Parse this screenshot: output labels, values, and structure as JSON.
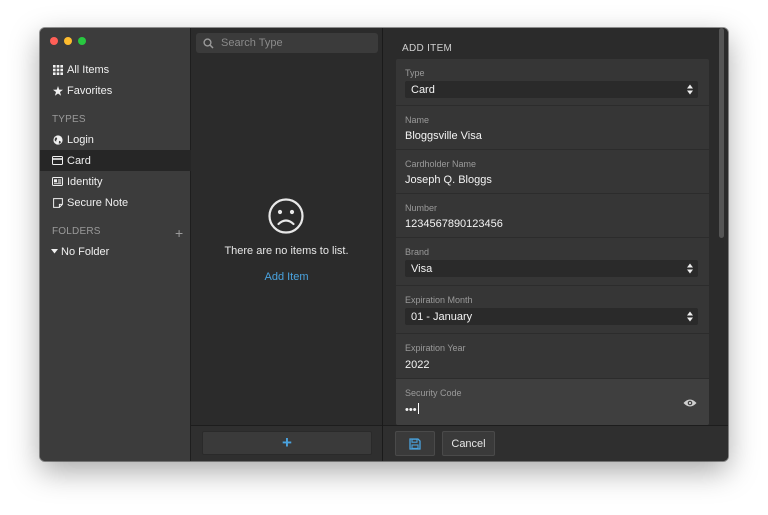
{
  "window": {
    "traffic_colors": {
      "close": "#ff5f57",
      "minimize": "#febc2e",
      "zoom": "#28c840"
    }
  },
  "sidebar": {
    "all_items": "All Items",
    "favorites": "Favorites",
    "types_heading": "TYPES",
    "types": [
      "Login",
      "Card",
      "Identity",
      "Secure Note"
    ],
    "active_type": "Card",
    "folders_heading": "FOLDERS",
    "no_folder": "No Folder"
  },
  "list": {
    "search_placeholder": "Search Type",
    "empty_message": "There are no items to list.",
    "add_item_link": "Add Item",
    "add_button": "+"
  },
  "form": {
    "title": "ADD ITEM",
    "type": {
      "label": "Type",
      "value": "Card"
    },
    "name": {
      "label": "Name",
      "value": "Bloggsville Visa"
    },
    "cardholder": {
      "label": "Cardholder Name",
      "value": "Joseph Q. Bloggs"
    },
    "number": {
      "label": "Number",
      "value": "1234567890123456"
    },
    "brand": {
      "label": "Brand",
      "value": "Visa"
    },
    "exp_month": {
      "label": "Expiration Month",
      "value": "01 - January"
    },
    "exp_year": {
      "label": "Expiration Year",
      "value": "2022"
    },
    "security_code": {
      "label": "Security Code",
      "value": "•••"
    }
  },
  "footer": {
    "cancel_label": "Cancel"
  },
  "colors": {
    "accent": "#4aa3df",
    "sidebar_bg": "#3c3c3c",
    "panel_bg": "#2b2b2b"
  }
}
